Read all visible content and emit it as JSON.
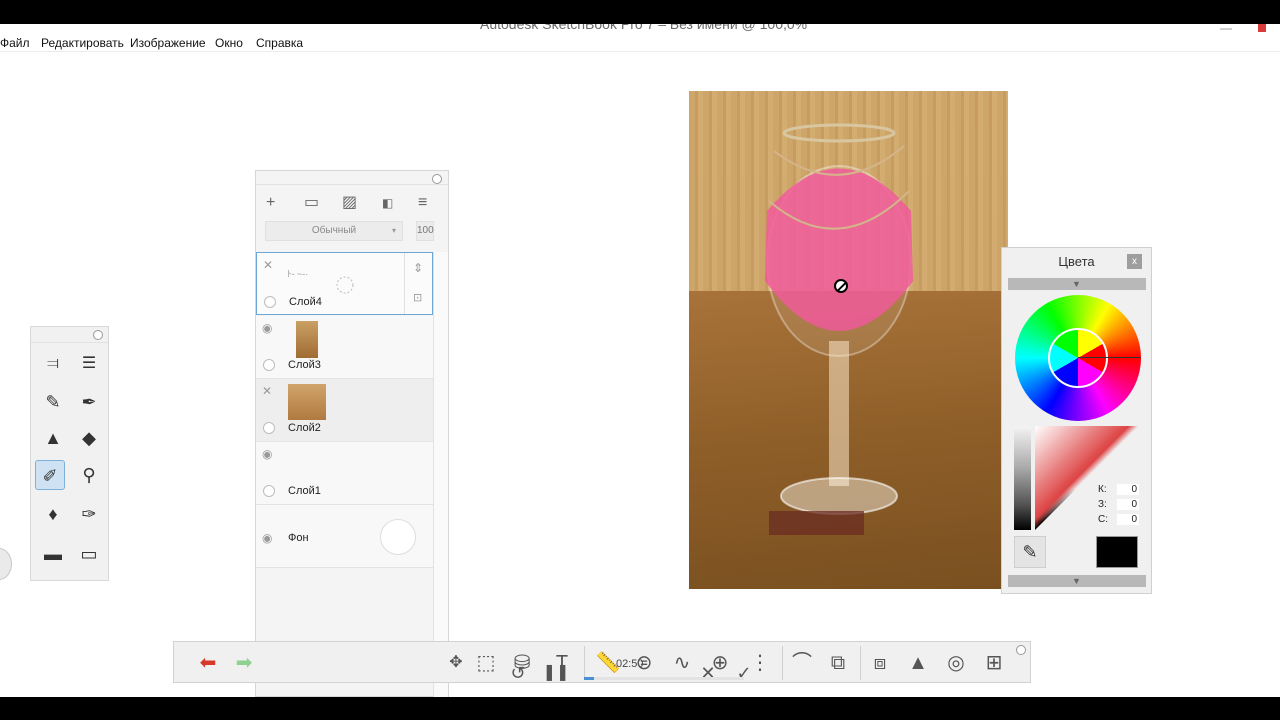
{
  "window": {
    "title": "Autodesk SketchBook Pro 7 – Без имени @ 100,0%"
  },
  "menu": {
    "items": [
      "Файл",
      "Редактировать",
      "Изображение",
      "Окно",
      "Справка"
    ]
  },
  "layers_panel": {
    "blend_mode": "Обычный",
    "opacity": "100",
    "layers": [
      {
        "name": "Слой4",
        "visible": false,
        "selected": true
      },
      {
        "name": "Слой3",
        "visible": true,
        "selected": false
      },
      {
        "name": "Слой2",
        "visible": false,
        "selected": false
      },
      {
        "name": "Слой1",
        "visible": true,
        "selected": false
      },
      {
        "name": "Фон",
        "visible": true,
        "selected": false
      }
    ]
  },
  "colors_panel": {
    "title": "Цвета",
    "close": "x",
    "k_label": "К:",
    "k_value": "0",
    "z_label": "З:",
    "z_value": "0",
    "c_label": "С:",
    "c_value": "0",
    "current_color": "#000000"
  },
  "toolbar": {
    "time": "02:50",
    "recording_progress": 0.06
  },
  "colors": {
    "selection": "#6aa7d6",
    "undo": "#d63a2a",
    "redo": "#8fd18f",
    "swatch": "#000000"
  }
}
